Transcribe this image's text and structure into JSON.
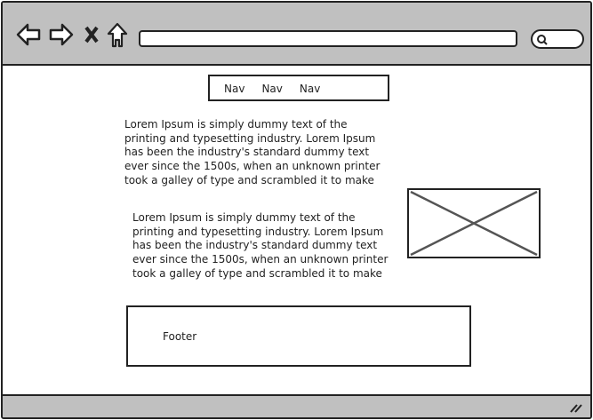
{
  "nav": {
    "items": [
      "Nav",
      "Nav",
      "Nav"
    ]
  },
  "paragraphs": [
    [
      "Lorem Ipsum is simply dummy text of the",
      "printing and typesetting industry. Lorem Ipsum",
      "has been the industry's standard dummy text",
      "ever since the 1500s, when an unknown printer",
      "took a galley of type and scrambled it to make"
    ],
    [
      "Lorem Ipsum is simply dummy text of the",
      "printing and typesetting industry. Lorem Ipsum",
      "has been the industry's standard dummy text",
      "ever since the 1500s, when an unknown printer",
      "took a galley of type and scrambled it to make"
    ]
  ],
  "footer": {
    "label": "Footer"
  }
}
